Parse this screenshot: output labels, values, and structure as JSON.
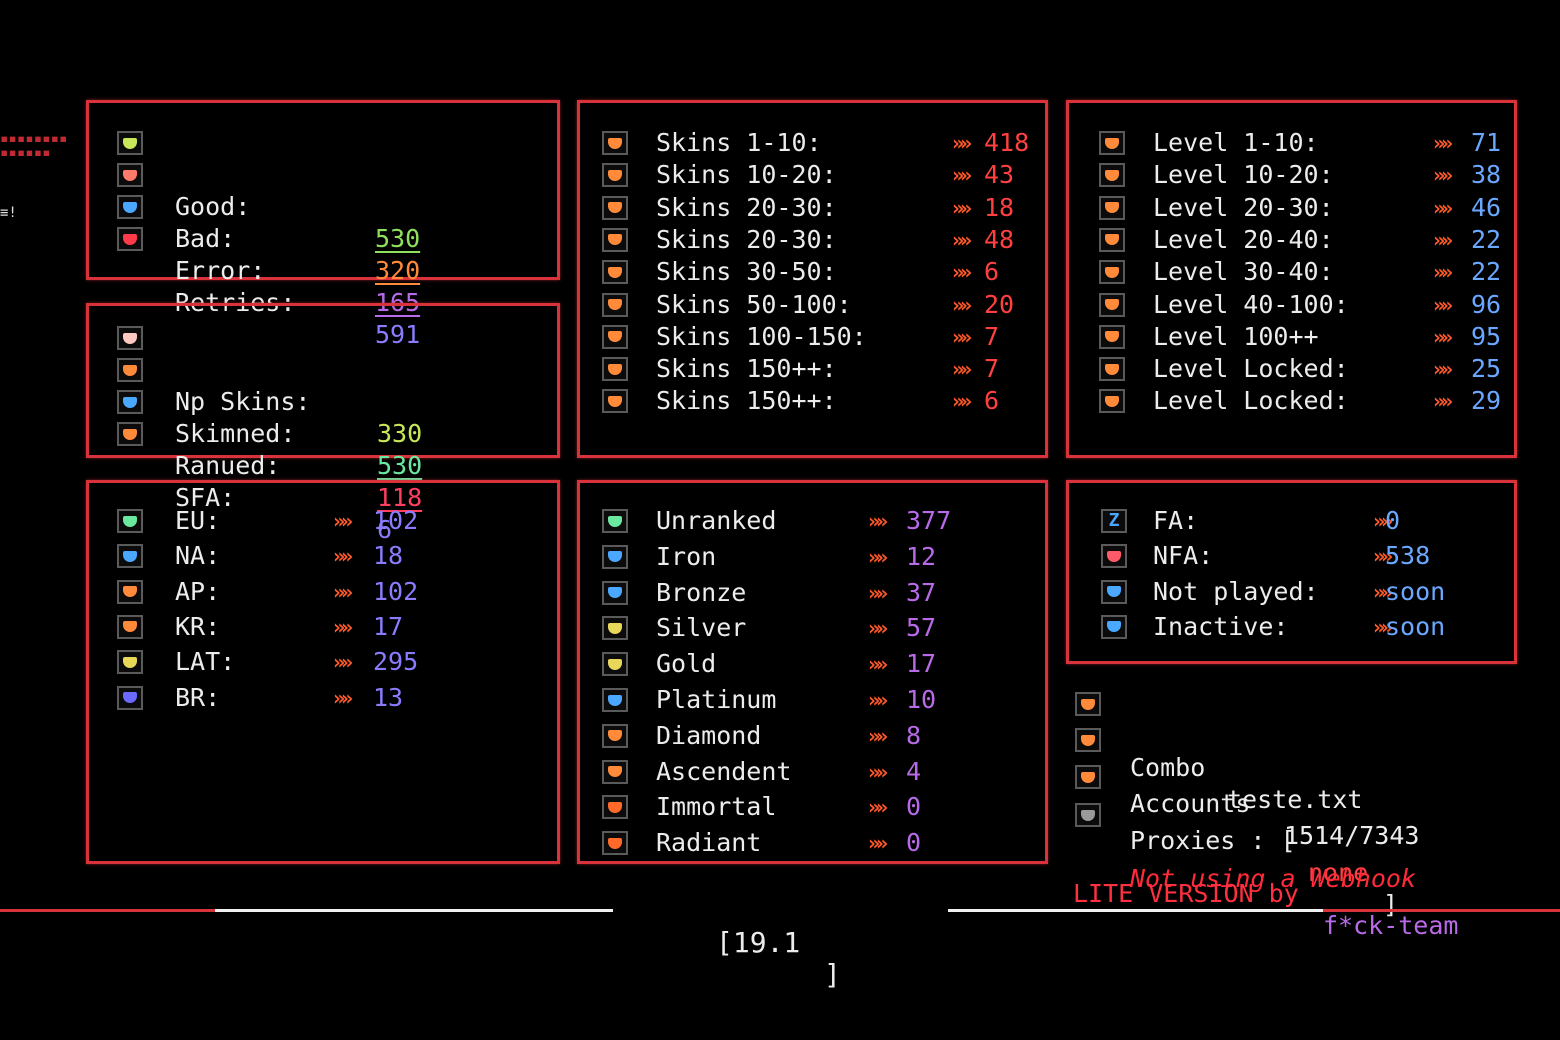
{
  "colors": {
    "panel_border": "#d8323a",
    "arrow": "#ff5a2a",
    "red_value": "#ff4040",
    "blue_value": "#6aa8ff",
    "purple_value": "#b86ae8",
    "violet_value": "#8a7cff"
  },
  "stats": [
    {
      "label": "Good:",
      "value": "530",
      "icon": "shield-green-icon"
    },
    {
      "label": "Bad:",
      "value": "320",
      "icon": "shield-red-icon"
    },
    {
      "label": "Error:",
      "value": "165",
      "icon": "shield-blue-icon"
    },
    {
      "label": "Retries:",
      "value": "591",
      "icon": "shield-crimson-icon"
    }
  ],
  "skin_stats": [
    {
      "label": "Np Skins:",
      "value": "330",
      "icon": "shield-white-icon"
    },
    {
      "label": "Skimned:",
      "value": "530",
      "icon": "shield-orange-icon"
    },
    {
      "label": "Ranued:",
      "value": "118",
      "icon": "shield-blue-icon"
    },
    {
      "label": "SFA:",
      "value": "6",
      "icon": "shield-orange-icon"
    }
  ],
  "skins": [
    {
      "label": "Skins 1-10:",
      "value": "418"
    },
    {
      "label": "Skins 10-20:",
      "value": "43"
    },
    {
      "label": "Skins 20-30:",
      "value": "18"
    },
    {
      "label": "Skins 20-30:",
      "value": "48"
    },
    {
      "label": "Skins 30-50:",
      "value": "6"
    },
    {
      "label": "Skins 50-100:",
      "value": "20"
    },
    {
      "label": "Skins 100-150:",
      "value": "7"
    },
    {
      "label": "Skins 150++:",
      "value": "7"
    },
    {
      "label": "Skins 150++:",
      "value": "6"
    }
  ],
  "levels": [
    {
      "label": "Level 1-10:",
      "value": "71"
    },
    {
      "label": "Level 10-20:",
      "value": "38"
    },
    {
      "label": "Level 20-30:",
      "value": "46"
    },
    {
      "label": "Level 20-40:",
      "value": "22"
    },
    {
      "label": "Level 30-40:",
      "value": "22"
    },
    {
      "label": "Level 40-100:",
      "value": "96"
    },
    {
      "label": "Level 100++",
      "value": "95"
    },
    {
      "label": "Level Locked:",
      "value": "25"
    },
    {
      "label": "Level Locked:",
      "value": "29"
    }
  ],
  "regions": [
    {
      "label": "EU:",
      "value": "102",
      "icon": "shield-green-icon"
    },
    {
      "label": "NA:",
      "value": "18",
      "icon": "shield-blue-icon"
    },
    {
      "label": "AP:",
      "value": "102",
      "icon": "shield-orange-icon"
    },
    {
      "label": "KR:",
      "value": "17",
      "icon": "shield-orange-icon"
    },
    {
      "label": "LAT:",
      "value": "295",
      "icon": "shield-yellow-icon"
    },
    {
      "label": "BR:",
      "value": "13",
      "icon": "shield-indigo-icon"
    }
  ],
  "ranks": [
    {
      "label": "Unranked",
      "value": "377",
      "icon": "unranked-icon"
    },
    {
      "label": "Iron",
      "value": "12",
      "icon": "iron-icon"
    },
    {
      "label": "Bronze",
      "value": "37",
      "icon": "bronze-icon"
    },
    {
      "label": "Silver",
      "value": "57",
      "icon": "silver-icon"
    },
    {
      "label": "Gold",
      "value": "17",
      "icon": "gold-icon"
    },
    {
      "label": "Platinum",
      "value": "10",
      "icon": "platinum-icon"
    },
    {
      "label": "Diamond",
      "value": "8",
      "icon": "diamond-icon"
    },
    {
      "label": "Ascendent",
      "value": "4",
      "icon": "ascendent-icon"
    },
    {
      "label": "Immortal",
      "value": "0",
      "icon": "immortal-icon"
    },
    {
      "label": "Radiant",
      "value": "0",
      "icon": "radiant-icon"
    }
  ],
  "access": [
    {
      "label": "FA:",
      "value": "0",
      "icon": "z-icon"
    },
    {
      "label": "NFA:",
      "value": "538",
      "icon": "shield-red-icon"
    },
    {
      "label": "Not played:",
      "value": "soon",
      "icon": "signal-icon"
    },
    {
      "label": "Inactive:",
      "value": "soon",
      "icon": "signal-icon"
    }
  ],
  "info": {
    "combo_label": "Combo",
    "combo_file": "teste.txt",
    "accounts_label": "Accounts",
    "accounts_value": "1514/7343",
    "proxies_label": "Proxies : [",
    "proxies_value": "none",
    "proxies_close": "]",
    "webhook_status": "Not using a Webhook"
  },
  "footer": {
    "version_prefix": "LITE VERSION by",
    "team": "f*ck-team",
    "counter": "[19.1",
    "counter_close": "]"
  }
}
